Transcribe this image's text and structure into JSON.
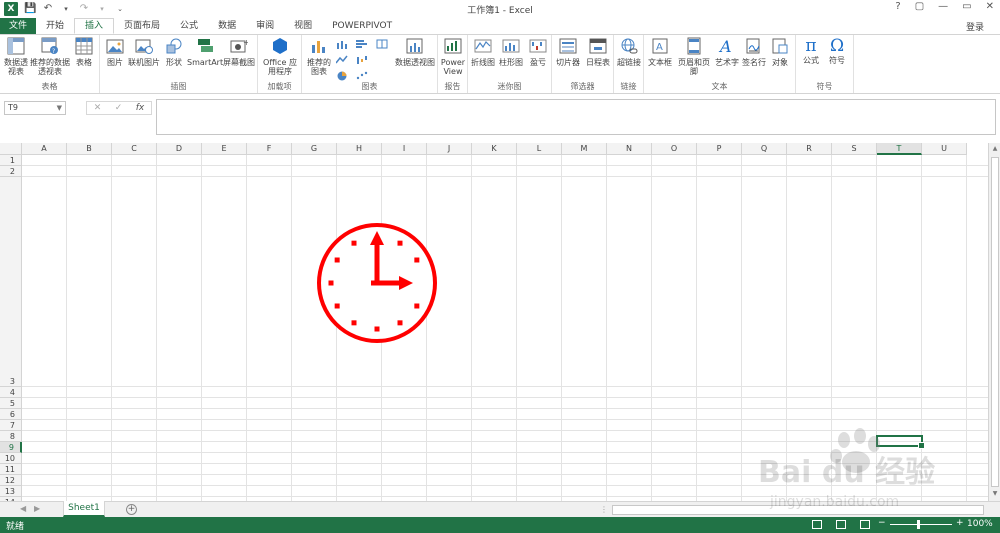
{
  "title_bar": {
    "app_logo": "X",
    "window_title": "工作簿1 - Excel",
    "controls": [
      "?",
      "▢",
      "—",
      "▭",
      "✕"
    ]
  },
  "tabs": {
    "file": "文件",
    "items": [
      "开始",
      "插入",
      "页面布局",
      "公式",
      "数据",
      "审阅",
      "视图",
      "POWERPIVOT"
    ],
    "active": "插入",
    "login": "登录"
  },
  "ribbon": {
    "groups": [
      {
        "label": "表格",
        "buttons": [
          "数据透视表",
          "推荐的数据透视表",
          "表格"
        ]
      },
      {
        "label": "插图",
        "buttons": [
          "图片",
          "联机图片",
          "形状",
          "SmartArt",
          "屏幕截图"
        ]
      },
      {
        "label": "加载项",
        "buttons": [
          "Office 应用程序"
        ]
      },
      {
        "label": "图表",
        "buttons": [
          "推荐的图表",
          "数据透视图"
        ]
      },
      {
        "label": "报告",
        "buttons": [
          "Power View"
        ]
      },
      {
        "label": "迷你图",
        "buttons": [
          "折线图",
          "柱形图",
          "盈亏"
        ]
      },
      {
        "label": "筛选器",
        "buttons": [
          "切片器",
          "日程表"
        ]
      },
      {
        "label": "链接",
        "buttons": [
          "超链接"
        ]
      },
      {
        "label": "文本",
        "buttons": [
          "文本框",
          "页眉和页脚",
          "艺术字",
          "签名行",
          "对象"
        ]
      },
      {
        "label": "符号",
        "buttons": [
          "公式",
          "符号"
        ]
      }
    ]
  },
  "formula_bar": {
    "name_box": "T9",
    "fx_label": "fx",
    "formula": ""
  },
  "grid": {
    "columns": [
      "A",
      "B",
      "C",
      "D",
      "E",
      "F",
      "G",
      "H",
      "I",
      "J",
      "K",
      "L",
      "M",
      "N",
      "O",
      "P",
      "Q",
      "R",
      "S",
      "T",
      "U"
    ],
    "rows": [
      "1",
      "2",
      "3",
      "4",
      "5",
      "6",
      "7",
      "8",
      "9",
      "10",
      "11",
      "12",
      "13",
      "14"
    ],
    "selected_column": "T",
    "selected_row": "9",
    "clock_color": "#ff0000"
  },
  "sheet_tabs": {
    "sheets": [
      "Sheet1"
    ],
    "add_label": "+"
  },
  "status_bar": {
    "status": "就绪",
    "zoom_minus": "−",
    "zoom_plus": "+",
    "zoom": "100%"
  },
  "watermark": {
    "brand": "Bai du 经验",
    "url": "jingyan.baidu.com"
  }
}
